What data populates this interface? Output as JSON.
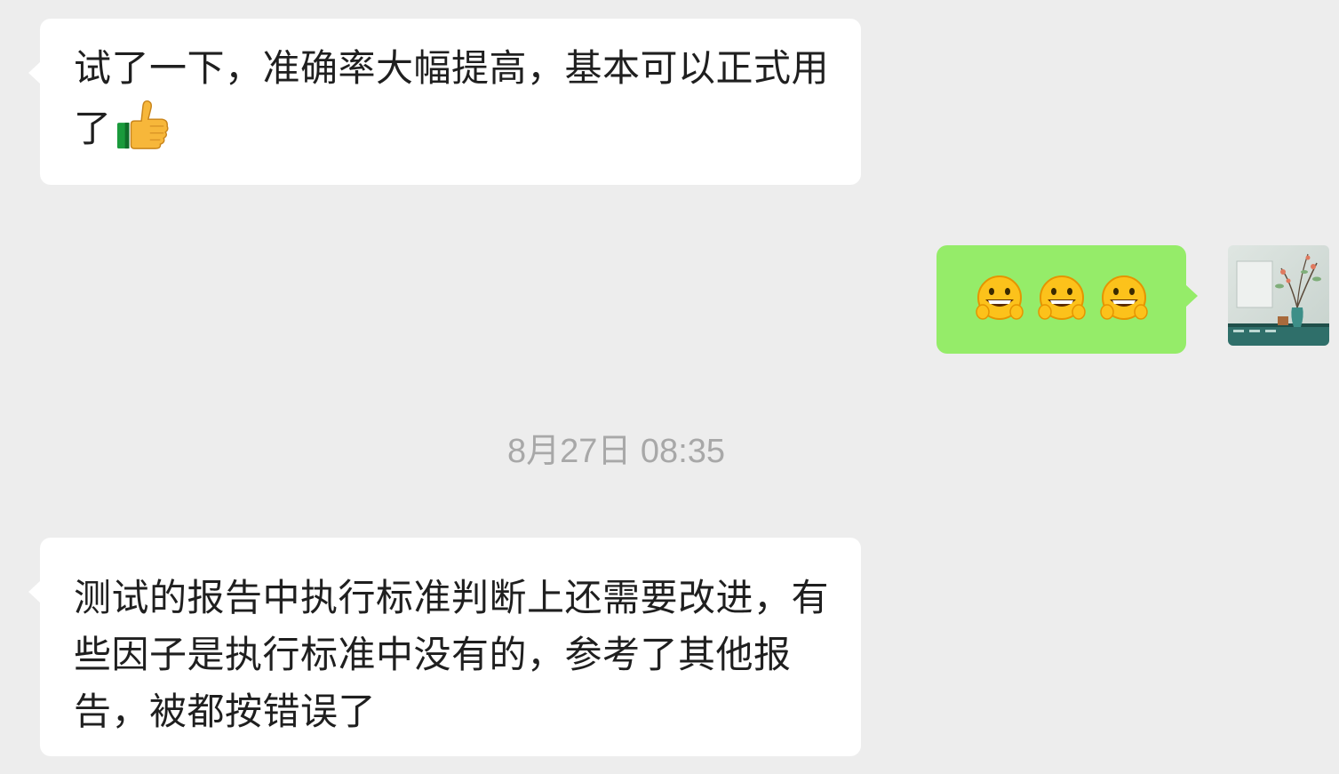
{
  "messages": [
    {
      "direction": "incoming",
      "text": "试了一下，准确率大幅提高，基本可以正式用了",
      "trailing_emoji": "thumbs-up"
    },
    {
      "direction": "outgoing",
      "emojis": [
        "grinning-face",
        "grinning-face",
        "grinning-face"
      ]
    },
    {
      "direction": "incoming",
      "text": "测试的报告中执行标准判断上还需要改进，有些因子是执行标准中没有的，参考了其他报告，被都按错误了"
    }
  ],
  "timestamp": "8月27日 08:35",
  "avatar": {
    "icon": "avatar-image-still-life"
  },
  "colors": {
    "background": "#ededed",
    "incoming_bubble": "#ffffff",
    "outgoing_bubble": "#95ec69",
    "timestamp_text": "#a8a8a8",
    "message_text": "#1f1f1f"
  }
}
